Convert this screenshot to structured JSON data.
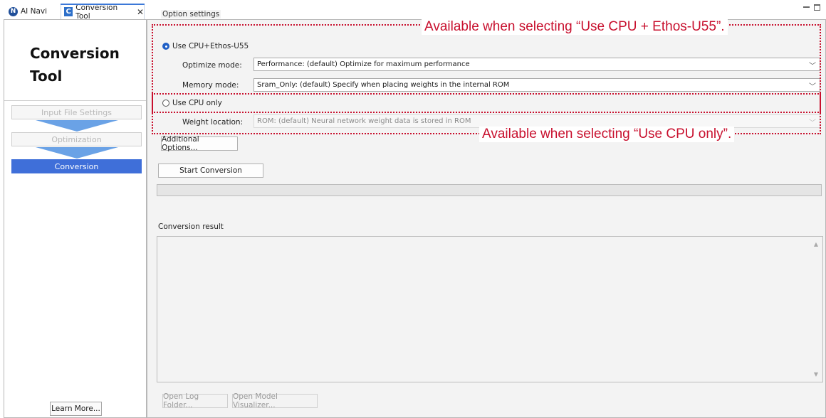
{
  "tabs": [
    {
      "label": "AI Navi",
      "icon": "ai-navi-icon"
    },
    {
      "label": "Conversion Tool",
      "icon": "conversion-tool-icon",
      "active": true
    }
  ],
  "sidebar": {
    "title": "Conversion\nTool",
    "steps": [
      {
        "label": "Input File Settings",
        "state": "disabled"
      },
      {
        "label": "Optimization",
        "state": "disabled"
      },
      {
        "label": "Conversion",
        "state": "active"
      }
    ],
    "learn_more": "Learn More..."
  },
  "options": {
    "legend": "Option settings",
    "radio_ethos": {
      "label": "Use CPU+Ethos-U55",
      "checked": true
    },
    "optimize_mode": {
      "label": "Optimize mode:",
      "value": "Performance: (default) Optimize for maximum performance"
    },
    "memory_mode": {
      "label": "Memory mode:",
      "value": "Sram_Only: (default) Specify when placing weights in the internal ROM"
    },
    "radio_cpu": {
      "label": "Use CPU only",
      "checked": false
    },
    "weight_location": {
      "label": "Weight location:",
      "value": "ROM: (default) Neural network weight data is stored in ROM",
      "disabled": true
    }
  },
  "buttons": {
    "additional_options": "Additional Options...",
    "start_conversion": "Start Conversion",
    "open_log_folder": "Open Log Folder...",
    "open_model_visualizer": "Open Model Visualizer..."
  },
  "progress": {
    "fraction": 0.0
  },
  "result": {
    "label": "Conversion result",
    "text": ""
  },
  "annotations": {
    "ethos_note": "Available when selecting “Use CPU + Ethos-U55”.",
    "cpu_note": "Available when selecting “Use CPU only”."
  },
  "colors": {
    "accent": "#3f6fd9",
    "annotation": "#c8102e"
  }
}
